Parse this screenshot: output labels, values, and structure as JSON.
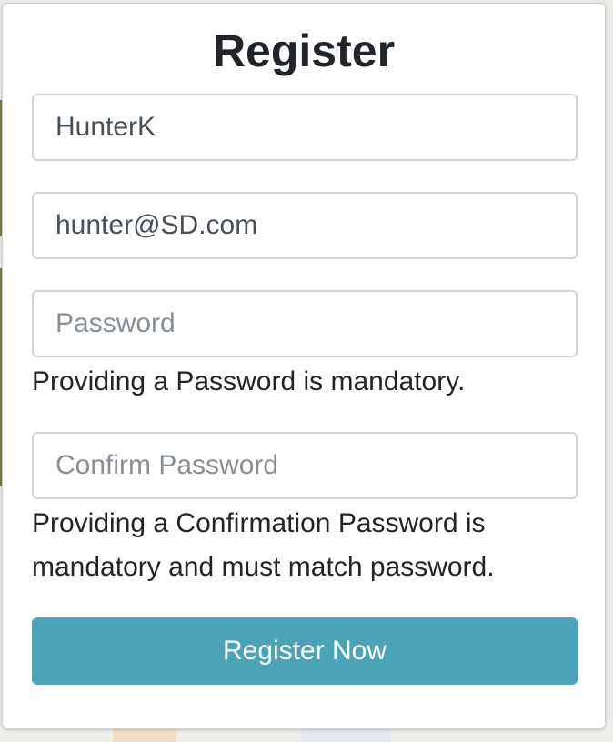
{
  "register": {
    "title": "Register",
    "username": {
      "value": "HunterK",
      "placeholder": ""
    },
    "email": {
      "value": "hunter@SD.com",
      "placeholder": ""
    },
    "password": {
      "value": "",
      "placeholder": "Password",
      "error": "Providing a Password is mandatory."
    },
    "confirm_password": {
      "value": "",
      "placeholder": "Confirm Password",
      "error": "Providing a Confirmation Password is mandatory and must match password."
    },
    "submit_label": "Register Now"
  },
  "colors": {
    "button": "#4aa3b6",
    "button_text": "#ffffff",
    "input_border": "#ced4da",
    "placeholder": "#878e95",
    "text": "#212529"
  }
}
